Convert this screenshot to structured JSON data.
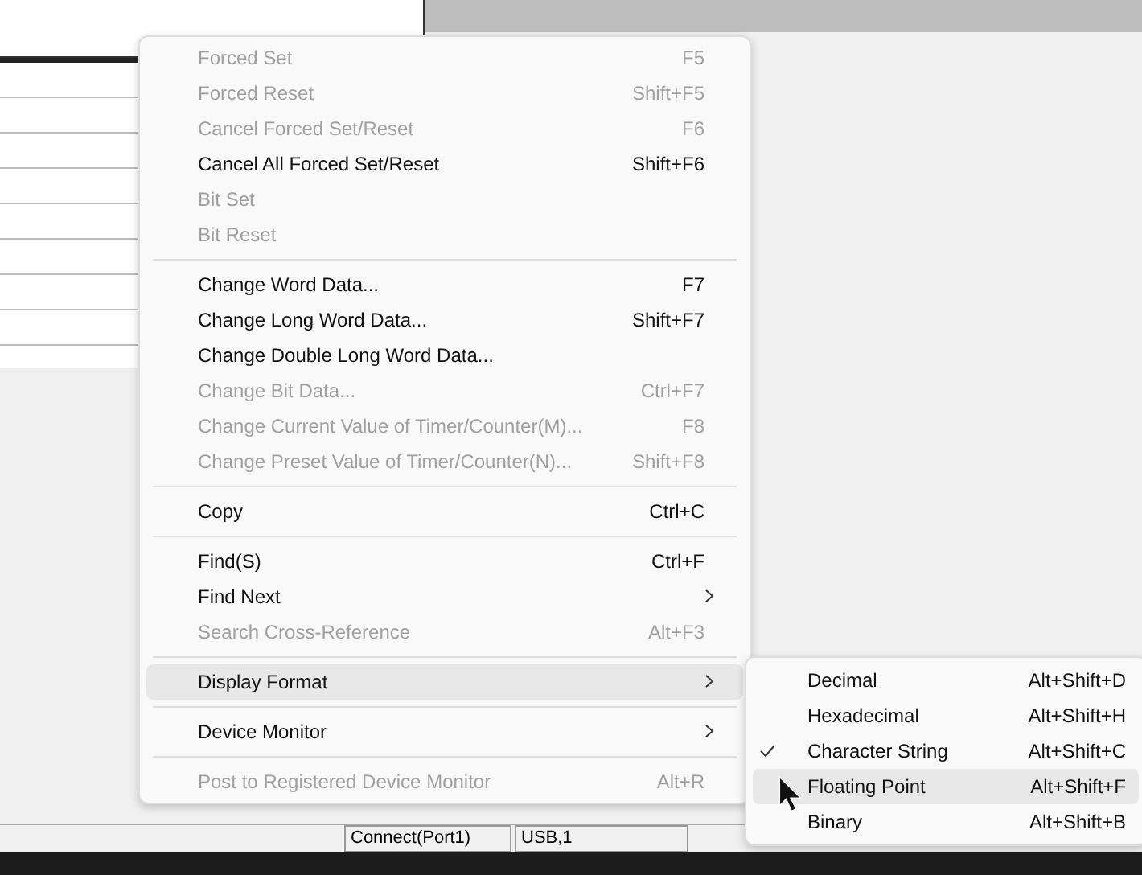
{
  "menu": {
    "groups": [
      [
        {
          "label": "Forced Set",
          "shortcut": "F5",
          "disabled": true
        },
        {
          "label": "Forced Reset",
          "shortcut": "Shift+F5",
          "disabled": true
        },
        {
          "label": "Cancel Forced Set/Reset",
          "shortcut": "F6",
          "disabled": true
        },
        {
          "label": "Cancel All Forced Set/Reset",
          "shortcut": "Shift+F6",
          "disabled": false
        },
        {
          "label": "Bit Set",
          "disabled": true
        },
        {
          "label": "Bit Reset",
          "disabled": true
        }
      ],
      [
        {
          "label": "Change Word Data...",
          "shortcut": "F7",
          "disabled": false
        },
        {
          "label": "Change Long Word Data...",
          "shortcut": "Shift+F7",
          "disabled": false
        },
        {
          "label": "Change Double Long Word Data...",
          "disabled": false
        },
        {
          "label": "Change Bit Data...",
          "shortcut": "Ctrl+F7",
          "disabled": true
        },
        {
          "label": "Change Current Value of Timer/Counter(M)...",
          "shortcut": "F8",
          "disabled": true
        },
        {
          "label": "Change Preset Value of Timer/Counter(N)...",
          "shortcut": "Shift+F8",
          "disabled": true
        }
      ],
      [
        {
          "label": "Copy",
          "shortcut": "Ctrl+C",
          "disabled": false
        }
      ],
      [
        {
          "label": "Find(S)",
          "shortcut": "Ctrl+F",
          "disabled": false
        },
        {
          "label": "Find Next",
          "submenu": true,
          "disabled": false
        },
        {
          "label": "Search Cross-Reference",
          "shortcut": "Alt+F3",
          "disabled": true
        }
      ],
      [
        {
          "label": "Display Format",
          "submenu": true,
          "disabled": false,
          "selected": true
        }
      ],
      [
        {
          "label": "Device Monitor",
          "submenu": true,
          "disabled": false,
          "selected": false
        }
      ],
      [
        {
          "label": "Post to Registered Device Monitor",
          "shortcut": "Alt+R",
          "disabled": true
        }
      ]
    ]
  },
  "submenu": {
    "items": [
      {
        "label": "Decimal",
        "shortcut": "Alt+Shift+D",
        "checked": false,
        "selected": false
      },
      {
        "label": "Hexadecimal",
        "shortcut": "Alt+Shift+H",
        "checked": false,
        "selected": false
      },
      {
        "label": "Character String",
        "shortcut": "Alt+Shift+C",
        "checked": true,
        "selected": false
      },
      {
        "label": "Floating Point",
        "shortcut": "Alt+Shift+F",
        "checked": false,
        "selected": true
      },
      {
        "label": "Binary",
        "shortcut": "Alt+Shift+B",
        "checked": false,
        "selected": false
      }
    ]
  },
  "status_bar": {
    "cells": [
      "Connect(Port1)",
      "USB,1"
    ]
  }
}
